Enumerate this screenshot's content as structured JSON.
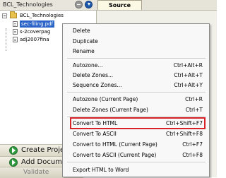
{
  "panel": {
    "title": "BCL_Technologies",
    "tree": {
      "root": "BCL_Technologies",
      "items": [
        "sec-filing.pdf",
        "s-2coverpag",
        "adj2007fina"
      ]
    }
  },
  "tabs": {
    "source": "Source"
  },
  "actions": {
    "create_project": "Create Proje",
    "add_documents": "Add Docume",
    "validate": "Validate"
  },
  "menu": {
    "items": [
      {
        "label": "Delete",
        "shortcut": ""
      },
      {
        "label": "Duplicate",
        "shortcut": ""
      },
      {
        "label": "Rename",
        "shortcut": ""
      },
      {
        "label": "Autozone...",
        "shortcut": "Ctrl+Alt+R"
      },
      {
        "label": "Delete Zones...",
        "shortcut": "Ctrl+Alt+T"
      },
      {
        "label": "Sequence Zones...",
        "shortcut": "Ctrl+Alt+Y"
      },
      {
        "label": "Autozone (Current Page)",
        "shortcut": "Ctrl+R"
      },
      {
        "label": "Delete Zones (Current Page)",
        "shortcut": "Ctrl+T"
      },
      {
        "label": "Convert To HTML",
        "shortcut": "Ctrl+Shift+F7"
      },
      {
        "label": "Convert To ASCII",
        "shortcut": "Ctrl+Shift+F8"
      },
      {
        "label": "Convert to HTML (Current Page)",
        "shortcut": "Ctrl+F7"
      },
      {
        "label": "Convert to ASCII (Current Page)",
        "shortcut": "Ctrl+F8"
      },
      {
        "label": "Export HTML to Word",
        "shortcut": ""
      }
    ],
    "highlighted": "Convert To HTML",
    "highlight_color": "#d7232a"
  },
  "icons": [
    "collapse-icon",
    "info-down-icon",
    "folder-icon",
    "document-icon",
    "play-icon"
  ]
}
